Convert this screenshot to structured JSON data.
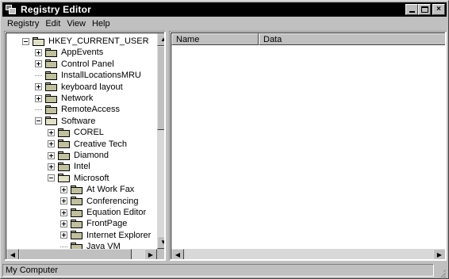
{
  "window": {
    "title": "Registry Editor",
    "controls": {
      "minimize": "minimize-icon",
      "maximize": "maximize-icon",
      "close": "×"
    }
  },
  "menu": [
    "Registry",
    "Edit",
    "View",
    "Help"
  ],
  "tree": {
    "items": [
      {
        "label": "HKEY_CURRENT_USER",
        "level": 0,
        "expander": "minus",
        "open": true
      },
      {
        "label": "AppEvents",
        "level": 1,
        "expander": "plus"
      },
      {
        "label": "Control Panel",
        "level": 1,
        "expander": "plus"
      },
      {
        "label": "InstallLocationsMRU",
        "level": 1,
        "expander": "none"
      },
      {
        "label": "keyboard layout",
        "level": 1,
        "expander": "plus"
      },
      {
        "label": "Network",
        "level": 1,
        "expander": "plus"
      },
      {
        "label": "RemoteAccess",
        "level": 1,
        "expander": "none"
      },
      {
        "label": "Software",
        "level": 1,
        "expander": "minus",
        "open": true
      },
      {
        "label": "COREL",
        "level": 2,
        "expander": "plus"
      },
      {
        "label": "Creative Tech",
        "level": 2,
        "expander": "plus"
      },
      {
        "label": "Diamond",
        "level": 2,
        "expander": "plus"
      },
      {
        "label": "Intel",
        "level": 2,
        "expander": "plus"
      },
      {
        "label": "Microsoft",
        "level": 2,
        "expander": "minus",
        "open": true
      },
      {
        "label": "At Work Fax",
        "level": 3,
        "expander": "plus"
      },
      {
        "label": "Conferencing",
        "level": 3,
        "expander": "plus"
      },
      {
        "label": "Equation Editor",
        "level": 3,
        "expander": "plus"
      },
      {
        "label": "FrontPage",
        "level": 3,
        "expander": "plus"
      },
      {
        "label": "Internet Explorer",
        "level": 3,
        "expander": "plus"
      },
      {
        "label": "Java VM",
        "level": 3,
        "expander": "none"
      }
    ]
  },
  "list": {
    "columns": [
      "Name",
      "Data"
    ]
  },
  "statusbar": {
    "text": "My Computer"
  },
  "icons": {
    "app": "registry-editor-icon",
    "folder": "folder-icon",
    "scroll_up": "▲",
    "scroll_down": "▼",
    "scroll_left": "◀",
    "scroll_right": "▶"
  }
}
